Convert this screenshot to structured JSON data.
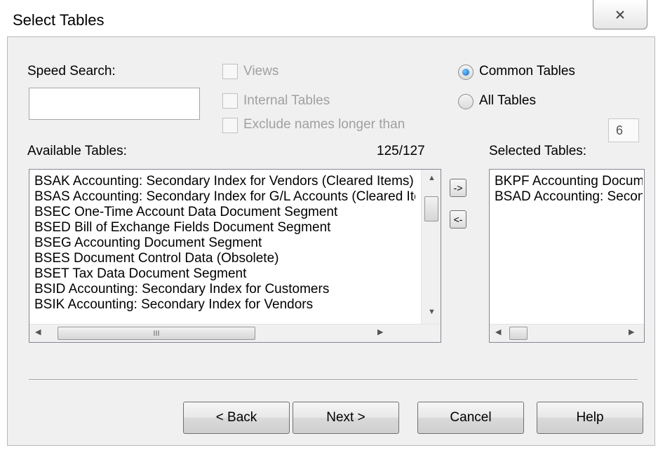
{
  "window": {
    "title": "Select Tables"
  },
  "speed_search": {
    "label": "Speed Search:",
    "value": ""
  },
  "filters": {
    "views_label": "Views",
    "internal_tables_label": "Internal Tables",
    "exclude_label": "Exclude names longer than",
    "length_value": "6"
  },
  "scope": {
    "common_label": "Common Tables",
    "all_label": "All Tables",
    "selected": "Common Tables"
  },
  "available": {
    "label": "Available Tables:",
    "count": "125/127",
    "items": [
      "BSAK Accounting: Secondary Index for Vendors (Cleared Items)",
      "BSAS Accounting: Secondary Index for G/L Accounts (Cleared Items)",
      "BSEC One-Time Account Data Document Segment",
      "BSED Bill of Exchange Fields Document Segment",
      "BSEG Accounting Document Segment",
      "BSES Document Control Data (Obsolete)",
      "BSET Tax Data Document Segment",
      "BSID Accounting: Secondary Index for Customers",
      "BSIK Accounting: Secondary Index for Vendors"
    ],
    "hscroll_glyph": "III"
  },
  "move": {
    "add_label": "->",
    "remove_label": "<-"
  },
  "selected": {
    "label": "Selected Tables:",
    "items": [
      "BKPF Accounting Document Header",
      "BSAD Accounting: Secondary Index for Customers"
    ]
  },
  "buttons": {
    "back": "< Back",
    "next": "Next >",
    "cancel": "Cancel",
    "help": "Help"
  },
  "icons": {
    "close": "close-x-icon",
    "up": "arrow-up-icon",
    "down": "arrow-down-icon",
    "left": "arrow-left-icon",
    "right": "arrow-right-icon"
  }
}
